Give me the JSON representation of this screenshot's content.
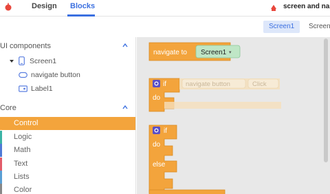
{
  "header": {
    "tabs": [
      {
        "label": "Design",
        "active": false
      },
      {
        "label": "Blocks",
        "active": true
      }
    ],
    "project_name": "screen and na",
    "accent_color": "#3a6fe0"
  },
  "screen_tabs": [
    {
      "label": "Screen1",
      "active": true
    },
    {
      "label": "Screen"
    }
  ],
  "sidebar": {
    "ui_components": {
      "title": "UI components",
      "tree": [
        {
          "label": "Screen1",
          "icon": "phone-icon",
          "expanded": true
        },
        {
          "label": "navigate button",
          "icon": "button-icon"
        },
        {
          "label": "Label1",
          "icon": "label-icon"
        }
      ]
    },
    "core": {
      "title": "Core",
      "categories": [
        {
          "label": "Control",
          "color": "#f3a43c",
          "active": true
        },
        {
          "label": "Logic",
          "color": "#3bb3a5"
        },
        {
          "label": "Math",
          "color": "#4f7ad6"
        },
        {
          "label": "Text",
          "color": "#e25c6a"
        },
        {
          "label": "Lists",
          "color": "#5a9fd4"
        },
        {
          "label": "Color",
          "color": "#888888"
        }
      ]
    }
  },
  "blocks": {
    "navigate": {
      "label": "navigate to",
      "dropdown": "Screen1"
    },
    "if_do": {
      "if_label": "if",
      "do_label": "do",
      "event_component": "navigate button",
      "event_name": "Click"
    },
    "if_do_else": {
      "if_label": "if",
      "do_label": "do",
      "else_label": "else"
    },
    "block_color": "#f3a43c"
  }
}
